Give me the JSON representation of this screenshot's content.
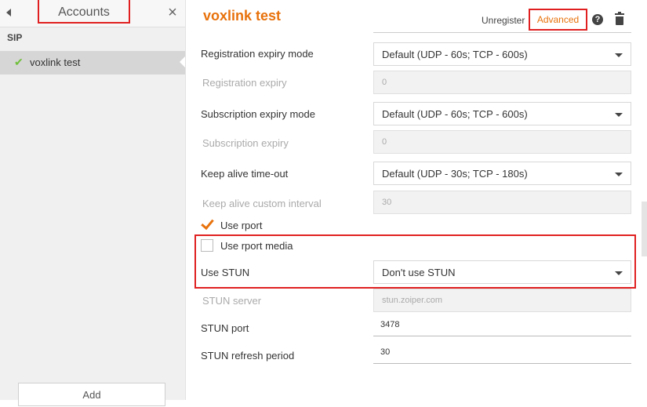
{
  "sidebar": {
    "title": "Accounts",
    "section": "SIP",
    "account": "voxlink test",
    "add_label": "Add"
  },
  "header": {
    "title": "voxlink test",
    "unregister": "Unregister",
    "advanced": "Advanced",
    "help_icon": "question-circle-icon",
    "delete_icon": "trash-icon"
  },
  "form": {
    "registration_expiry_mode_label": "Registration expiry mode",
    "registration_expiry_mode_value": "Default (UDP - 60s; TCP - 600s)",
    "registration_expiry_label": "Registration expiry",
    "registration_expiry_value": "0",
    "subscription_expiry_mode_label": "Subscription expiry mode",
    "subscription_expiry_mode_value": "Default (UDP - 60s; TCP - 600s)",
    "subscription_expiry_label": "Subscription expiry",
    "subscription_expiry_value": "0",
    "keep_alive_label": "Keep alive time-out",
    "keep_alive_value": "Default (UDP - 30s; TCP - 180s)",
    "keep_alive_interval_label": "Keep alive custom interval",
    "keep_alive_interval_value": "30",
    "use_rport_label": "Use rport",
    "use_rport_checked": true,
    "use_rport_media_label": "Use rport media",
    "use_rport_media_checked": false,
    "use_stun_label": "Use STUN",
    "use_stun_value": "Don't use STUN",
    "stun_server_label": "STUN server",
    "stun_server_placeholder": "stun.zoiper.com",
    "stun_port_label": "STUN port",
    "stun_port_value": "3478",
    "stun_refresh_label": "STUN refresh period",
    "stun_refresh_value": "30"
  },
  "colors": {
    "accent": "#e8720c",
    "highlight": "#e02020",
    "check_green": "#6fbf3a"
  }
}
